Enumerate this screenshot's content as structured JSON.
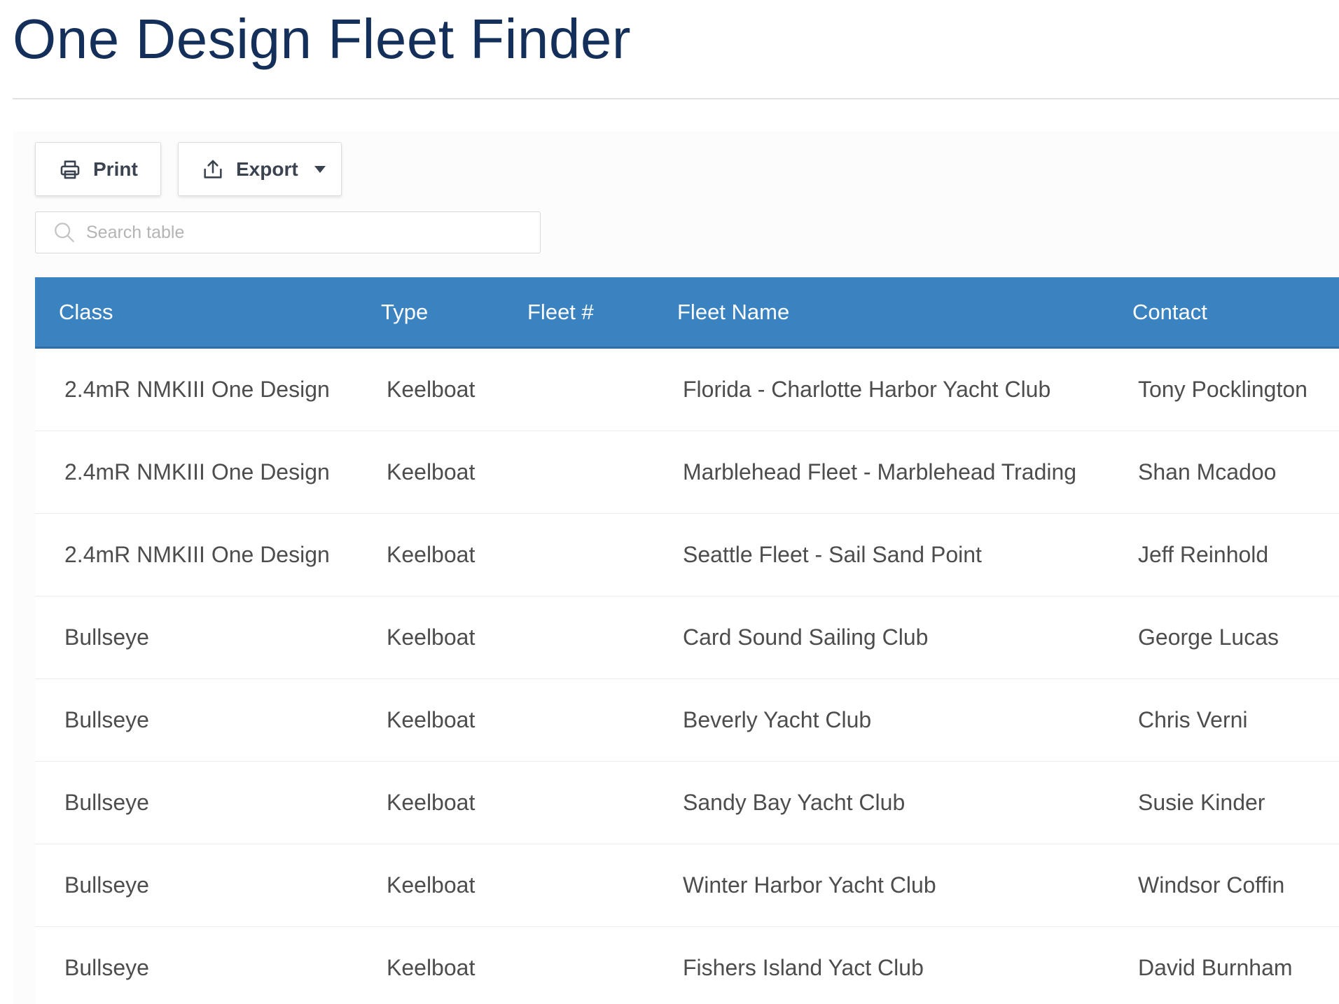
{
  "page": {
    "title": "One Design Fleet Finder"
  },
  "toolbar": {
    "print_label": "Print",
    "export_label": "Export"
  },
  "search": {
    "placeholder": "Search table",
    "value": ""
  },
  "table": {
    "headers": [
      "Class",
      "Type",
      "Fleet #",
      "Fleet Name",
      "Contact"
    ],
    "rows": [
      {
        "class": "2.4mR NMKIII One Design",
        "type": "Keelboat",
        "fleet_num": "",
        "fleet_name": "Florida - Charlotte Harbor Yacht Club",
        "contact": "Tony Pocklington"
      },
      {
        "class": "2.4mR NMKIII One Design",
        "type": "Keelboat",
        "fleet_num": "",
        "fleet_name": "Marblehead Fleet - Marblehead Trading",
        "contact": "Shan Mcadoo"
      },
      {
        "class": "2.4mR NMKIII One Design",
        "type": "Keelboat",
        "fleet_num": "",
        "fleet_name": "Seattle Fleet - Sail Sand Point",
        "contact": "Jeff Reinhold"
      },
      {
        "class": "Bullseye",
        "type": "Keelboat",
        "fleet_num": "",
        "fleet_name": "Card Sound Sailing Club",
        "contact": "George Lucas"
      },
      {
        "class": "Bullseye",
        "type": "Keelboat",
        "fleet_num": "",
        "fleet_name": "Beverly Yacht Club",
        "contact": "Chris Verni"
      },
      {
        "class": "Bullseye",
        "type": "Keelboat",
        "fleet_num": "",
        "fleet_name": "Sandy Bay Yacht Club",
        "contact": "Susie Kinder"
      },
      {
        "class": "Bullseye",
        "type": "Keelboat",
        "fleet_num": "",
        "fleet_name": "Winter Harbor Yacht Club",
        "contact": "Windsor Coffin"
      },
      {
        "class": "Bullseye",
        "type": "Keelboat",
        "fleet_num": "",
        "fleet_name": "Fishers Island Yact Club",
        "contact": "David Burnham"
      }
    ]
  },
  "icons": {
    "print": "printer-icon",
    "export": "upload-icon",
    "export_menu": "caret-down-icon",
    "search": "search-icon"
  },
  "colors": {
    "title": "#14305a",
    "header_bg": "#3a83c0",
    "header_text": "#ffffff",
    "cell_text": "#4d4d4d"
  }
}
